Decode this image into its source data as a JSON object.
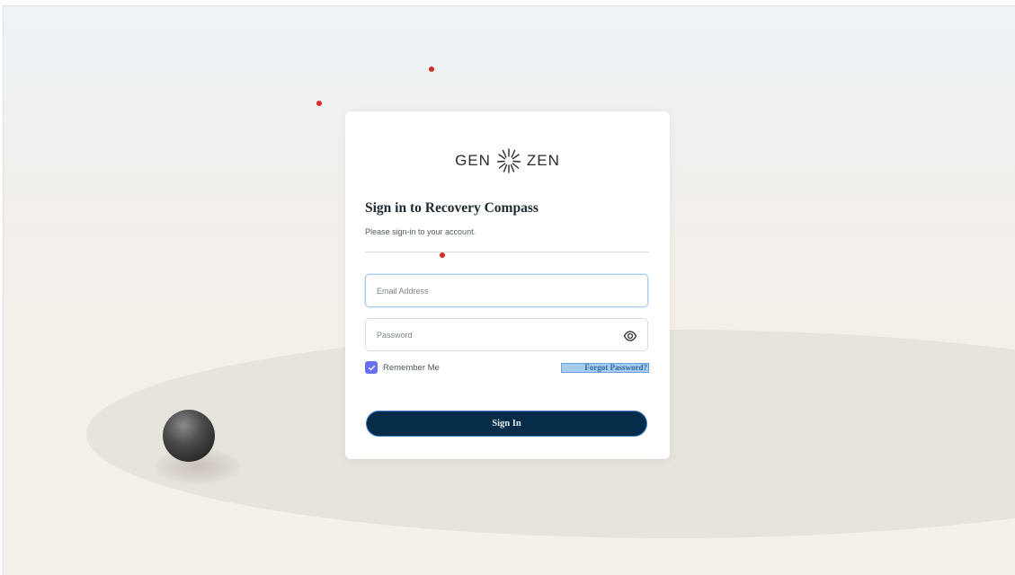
{
  "logo": {
    "left_text": "GEN",
    "right_text": "ZEN",
    "mark_icon": "sunburst-icon"
  },
  "signin": {
    "title": "Sign in to Recovery Compass",
    "subtitle": "Please sign-in to your account."
  },
  "form": {
    "email": {
      "placeholder": "Email Address",
      "value": ""
    },
    "password": {
      "placeholder": "Password",
      "value": "",
      "toggle_icon": "eye-icon"
    },
    "remember": {
      "label": "Remember Me",
      "checked": true
    },
    "forgot_label": "Forgot Password?",
    "submit_label": "Sign In"
  },
  "colors": {
    "primary_button": "#052c48",
    "checkbox": "#6a6ff0",
    "marker_dots": "#d82b2b"
  }
}
